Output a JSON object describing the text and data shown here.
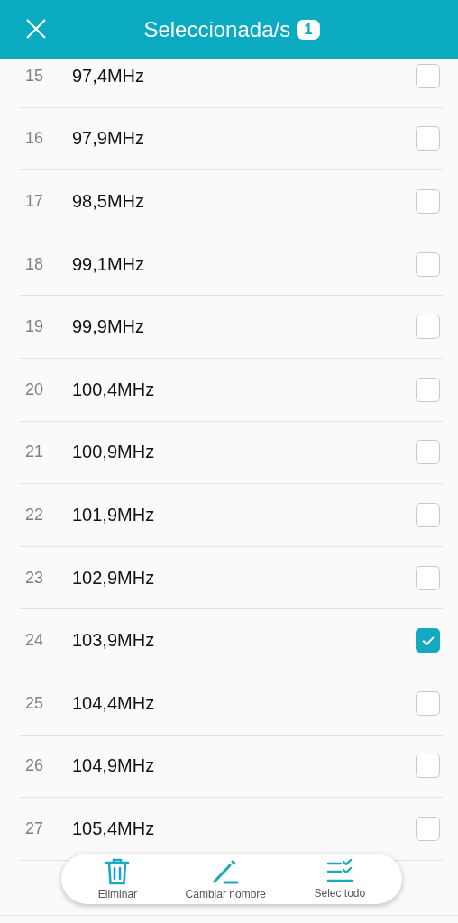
{
  "header": {
    "title": "Seleccionada/s",
    "count": "1"
  },
  "stations": [
    {
      "number": "15",
      "frequency": "97,4MHz",
      "checked": false
    },
    {
      "number": "16",
      "frequency": "97,9MHz",
      "checked": false
    },
    {
      "number": "17",
      "frequency": "98,5MHz",
      "checked": false
    },
    {
      "number": "18",
      "frequency": "99,1MHz",
      "checked": false
    },
    {
      "number": "19",
      "frequency": "99,9MHz",
      "checked": false
    },
    {
      "number": "20",
      "frequency": "100,4MHz",
      "checked": false
    },
    {
      "number": "21",
      "frequency": "100,9MHz",
      "checked": false
    },
    {
      "number": "22",
      "frequency": "101,9MHz",
      "checked": false
    },
    {
      "number": "23",
      "frequency": "102,9MHz",
      "checked": false
    },
    {
      "number": "24",
      "frequency": "103,9MHz",
      "checked": true
    },
    {
      "number": "25",
      "frequency": "104,4MHz",
      "checked": false
    },
    {
      "number": "26",
      "frequency": "104,9MHz",
      "checked": false
    },
    {
      "number": "27",
      "frequency": "105,4MHz",
      "checked": false
    }
  ],
  "actions": [
    {
      "kind": "delete",
      "label": "Eliminar"
    },
    {
      "kind": "rename",
      "label": "Cambiar nombre"
    },
    {
      "kind": "select_all",
      "label": "Selec todo"
    }
  ]
}
